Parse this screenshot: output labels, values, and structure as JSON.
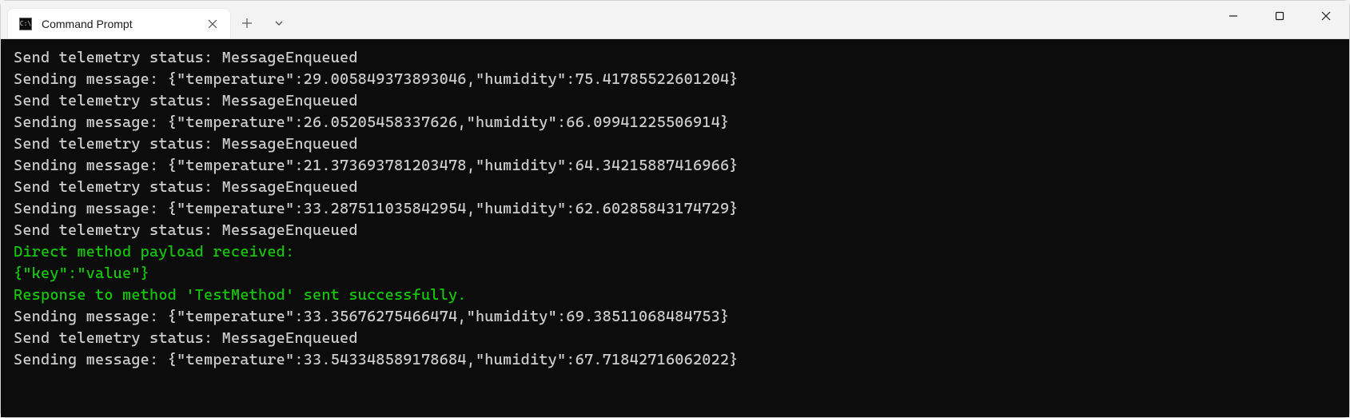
{
  "tab": {
    "title": "Command Prompt"
  },
  "terminal": {
    "lines": [
      {
        "text": "Send telemetry status: MessageEnqueued",
        "color": "default"
      },
      {
        "text": "Sending message: {\"temperature\":29.005849373893046,\"humidity\":75.41785522601204}",
        "color": "default"
      },
      {
        "text": "Send telemetry status: MessageEnqueued",
        "color": "default"
      },
      {
        "text": "Sending message: {\"temperature\":26.05205458337626,\"humidity\":66.09941225506914}",
        "color": "default"
      },
      {
        "text": "Send telemetry status: MessageEnqueued",
        "color": "default"
      },
      {
        "text": "Sending message: {\"temperature\":21.373693781203478,\"humidity\":64.34215887416966}",
        "color": "default"
      },
      {
        "text": "Send telemetry status: MessageEnqueued",
        "color": "default"
      },
      {
        "text": "Sending message: {\"temperature\":33.287511035842954,\"humidity\":62.60285843174729}",
        "color": "default"
      },
      {
        "text": "Send telemetry status: MessageEnqueued",
        "color": "default"
      },
      {
        "text": "Direct method payload received:",
        "color": "green"
      },
      {
        "text": "{\"key\":\"value\"}",
        "color": "green"
      },
      {
        "text": "Response to method 'TestMethod' sent successfully.",
        "color": "green"
      },
      {
        "text": "Sending message: {\"temperature\":33.35676275466474,\"humidity\":69.38511068484753}",
        "color": "default"
      },
      {
        "text": "Send telemetry status: MessageEnqueued",
        "color": "default"
      },
      {
        "text": "Sending message: {\"temperature\":33.543348589178684,\"humidity\":67.71842716062022}",
        "color": "default"
      }
    ]
  }
}
